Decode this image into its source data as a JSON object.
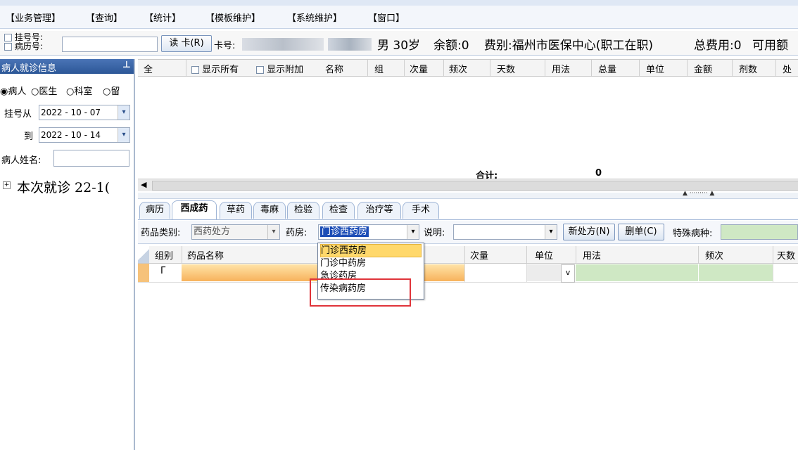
{
  "menu": [
    "【业务管理】",
    "【查询】",
    "【统计】",
    "【模板维护】",
    "【系统维护】",
    "【窗口】"
  ],
  "patient_bar": {
    "check_reg": "挂号号:",
    "check_record": "病历号:",
    "read_card": "读 卡(R)",
    "card_label": "卡号:",
    "gender_age": "男 30岁",
    "balance": "余额:0",
    "fee_type": "费别:福州市医保中心(职工在职)",
    "total": "总费用:0",
    "available": "可用额"
  },
  "left_panel": {
    "header": "病人就诊信息",
    "pin": "ᵖ",
    "radios": [
      "病人",
      "医生",
      "科室",
      "留"
    ],
    "date_from_label": "挂号从",
    "date_from": "2022 - 10 - 07",
    "date_to_label": "到",
    "date_to": "2022 - 10 - 14",
    "name_label": "病人姓名:",
    "tree_item": "本次就诊 22-1("
  },
  "order_grid": {
    "all": "全",
    "show_all": "显示所有",
    "show_extra": "显示附加",
    "columns": [
      "名称",
      "组",
      "次量",
      "频次",
      "天数",
      "用法",
      "总量",
      "单位",
      "金额",
      "剂数",
      "处"
    ],
    "total_label": "合计:",
    "total_value": "0"
  },
  "tabs": [
    "病历",
    "西成药",
    "草药",
    "毒麻",
    "检验",
    "检查",
    "治疗等",
    "手术"
  ],
  "form": {
    "category_label": "药品类别:",
    "category_value": "西药处方",
    "pharmacy_label": "药房:",
    "pharmacy_value": "门诊西药房",
    "note_label": "说明:",
    "new_rx": "新处方(N)",
    "delete": "删单(C)",
    "special_label": "特殊病种:"
  },
  "rx_grid": {
    "columns": [
      "组别",
      "药品名称",
      "次量",
      "单位",
      "用法",
      "频次",
      "天数"
    ],
    "check_mark": "Γ"
  },
  "pharmacy_options": [
    "门诊西药房",
    "门诊中药房",
    "急诊药房",
    "传染病药房"
  ]
}
